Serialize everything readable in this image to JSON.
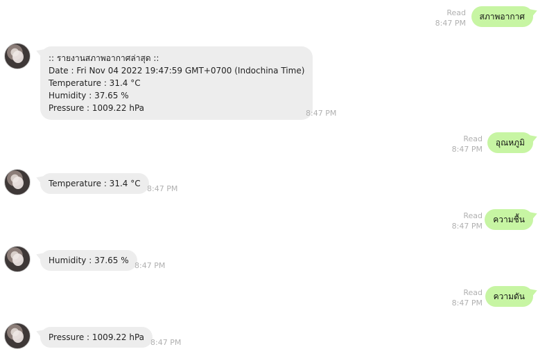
{
  "messages": [
    {
      "type": "outgoing",
      "status": "Read",
      "time": "8:47 PM",
      "text": "สภาพอากาศ"
    },
    {
      "type": "incoming",
      "time": "8:47 PM",
      "lines": [
        ":: รายงานสภาพอากาศล่าสุด ::",
        "Date : Fri Nov 04 2022 19:47:59 GMT+0700 (Indochina Time)",
        "Temperature : 31.4 °C",
        "Humidity : 37.65 %",
        "Pressure : 1009.22 hPa"
      ]
    },
    {
      "type": "outgoing",
      "status": "Read",
      "time": "8:47 PM",
      "text": "อุณหภูมิ"
    },
    {
      "type": "incoming",
      "time": "8:47 PM",
      "text": "Temperature : 31.4 °C"
    },
    {
      "type": "outgoing",
      "status": "Read",
      "time": "8:47 PM",
      "text": "ความชื้น"
    },
    {
      "type": "incoming",
      "time": "8:47 PM",
      "text": "Humidity : 37.65 %"
    },
    {
      "type": "outgoing",
      "status": "Read",
      "time": "8:47 PM",
      "text": "ความดัน"
    },
    {
      "type": "incoming",
      "time": "8:47 PM",
      "text": "Pressure : 1009.22 hPa"
    }
  ],
  "colors": {
    "outgoing_bubble": "#c7f5a3",
    "incoming_bubble": "#ededed",
    "meta_text": "#b0b0b0"
  }
}
